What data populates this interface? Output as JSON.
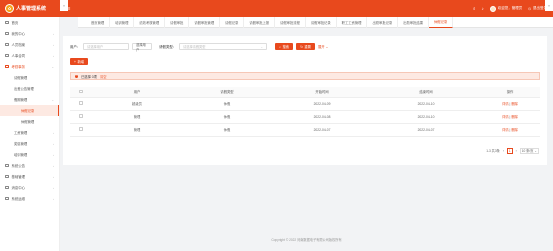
{
  "header": {
    "app_title": "人事管理系统",
    "user_label": "欢迎您，管理员",
    "logout_label": "退出登录",
    "menu_icon": "hamburger-icon",
    "accent": "#e8491d"
  },
  "tabs": [
    {
      "label": "首页管理",
      "active": false
    },
    {
      "label": "培训管理",
      "active": false
    },
    {
      "label": "绩效考核管理",
      "active": false
    },
    {
      "label": "请假审批",
      "active": false
    },
    {
      "label": "请假审批管理",
      "active": false
    },
    {
      "label": "请假记录",
      "active": false
    },
    {
      "label": "请假审批上报",
      "active": false
    },
    {
      "label": "请假审批流程",
      "active": false
    },
    {
      "label": "请假审批记录",
      "active": false
    },
    {
      "label": "职工工资管理",
      "active": false
    },
    {
      "label": "出勤审批记录",
      "active": false
    },
    {
      "label": "出勤审批结果",
      "active": false
    },
    {
      "label": "休假记录",
      "active": true
    }
  ],
  "sidebar": {
    "items": [
      {
        "label": "首页",
        "type": "item",
        "icon": "home-icon"
      },
      {
        "label": "我的中心",
        "type": "item",
        "icon": "user-icon",
        "arrow": "›"
      },
      {
        "label": "人员档案",
        "type": "item",
        "icon": "profile-icon",
        "arrow": "›"
      },
      {
        "label": "人事合同",
        "type": "item",
        "icon": "contract-icon",
        "arrow": "›"
      },
      {
        "label": "考勤事务",
        "type": "open",
        "icon": "calendar-icon",
        "arrow": "⌄"
      },
      {
        "label": "请假管理",
        "type": "sub"
      },
      {
        "label": "出差公告管理",
        "type": "sub"
      },
      {
        "label": "假期管理",
        "type": "sub",
        "arrow": "⌄"
      },
      {
        "label": "休假记录",
        "type": "sub2",
        "active": true
      },
      {
        "label": "休假管理",
        "type": "sub2"
      },
      {
        "label": "工资管理",
        "type": "sub",
        "arrow": "›"
      },
      {
        "label": "奖惩管理",
        "type": "sub",
        "arrow": "›"
      },
      {
        "label": "培训管理",
        "type": "sub",
        "arrow": "›"
      },
      {
        "label": "系统公告",
        "type": "item",
        "icon": "notice-icon",
        "arrow": "›"
      },
      {
        "label": "基础管理",
        "type": "item",
        "icon": "settings-icon",
        "arrow": "›"
      },
      {
        "label": "消息中心",
        "type": "item",
        "icon": "message-icon",
        "arrow": "›"
      },
      {
        "label": "系统运维",
        "type": "item",
        "icon": "tools-icon",
        "arrow": "›"
      }
    ]
  },
  "search": {
    "user_label": "用户：",
    "user_placeholder": "请选择用户",
    "user_button": "选择用户",
    "type_label": "请假类型：",
    "type_placeholder": "请选择请假类型",
    "search_button": "搜索",
    "reset_button": "重置",
    "expand_link": "展开"
  },
  "toolbar": {
    "add_label": "新增"
  },
  "alert": {
    "text": "已选择 0项",
    "clear": "清空"
  },
  "table": {
    "columns": [
      "",
      "用户",
      "请假类型",
      "开始时间",
      "结束时间",
      "操作"
    ],
    "rows": [
      {
        "user": "超级员",
        "type": "休假",
        "start": "2022-04-09",
        "end": "2022-04-10"
      },
      {
        "user": "管理",
        "type": "休假",
        "start": "2022-04-08",
        "end": "2022-04-10"
      },
      {
        "user": "管理",
        "type": "休假",
        "start": "2022-04-07",
        "end": "2022-04-07"
      }
    ],
    "op_edit": "详情",
    "op_delete": "删除"
  },
  "pager": {
    "summary": "1-3 共3条",
    "prev": "‹",
    "page": "1",
    "next": "›",
    "size": "10 条/页"
  },
  "footer": {
    "text": "Copyright © 2022 河南数据电子有限公司版权所有"
  }
}
